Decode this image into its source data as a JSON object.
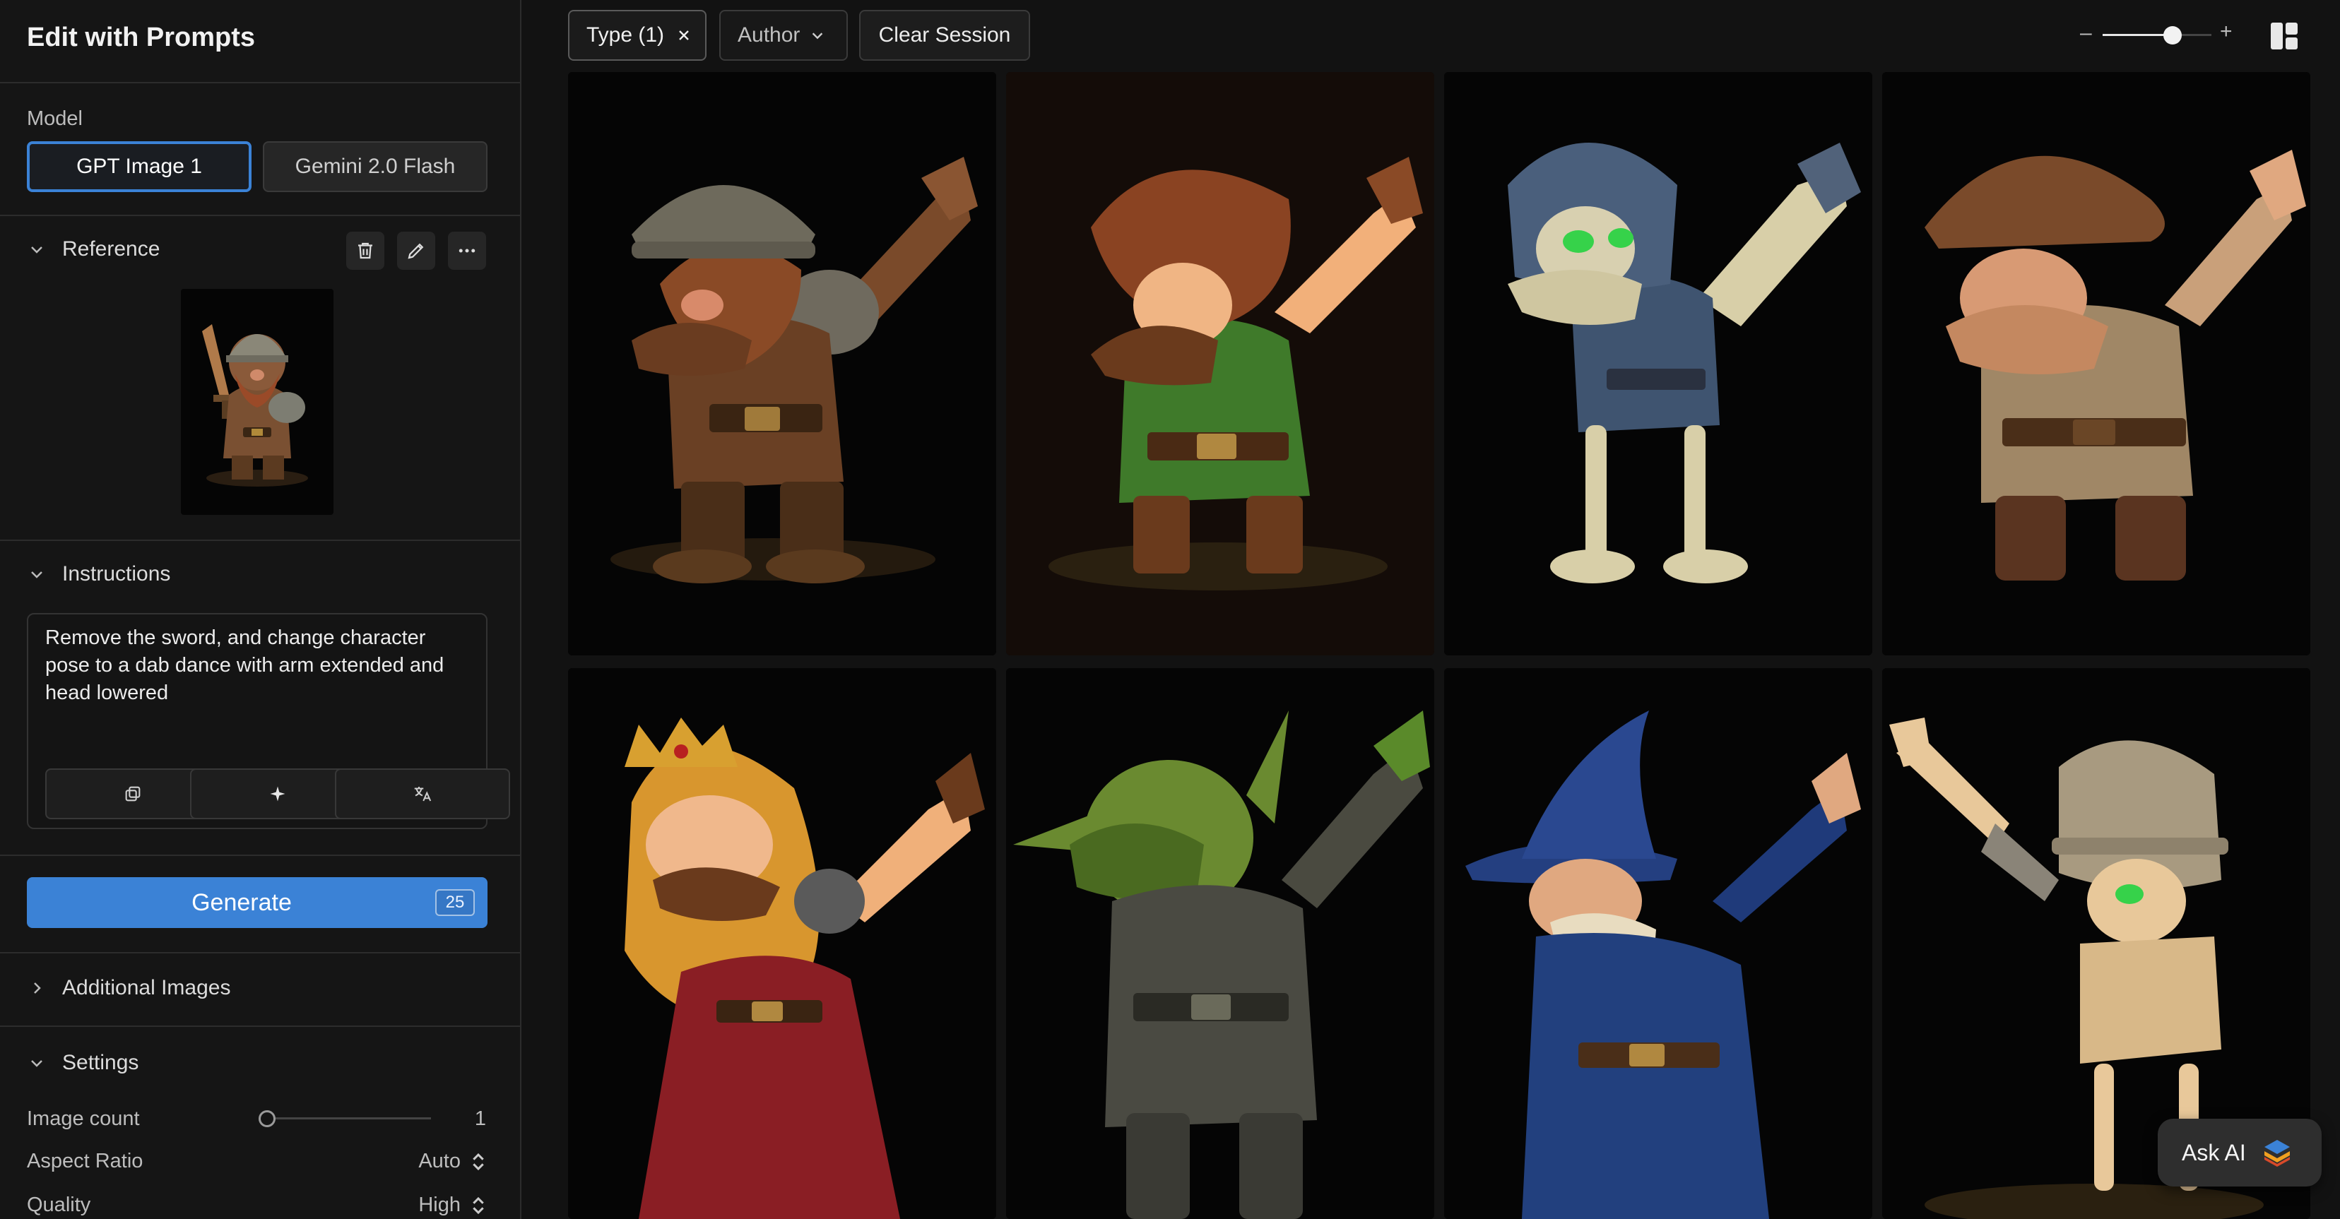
{
  "sidebar": {
    "title": "Edit with Prompts",
    "model": {
      "label": "Model",
      "options": [
        {
          "label": "GPT Image 1",
          "selected": true
        },
        {
          "label": "Gemini 2.0 Flash",
          "selected": false
        }
      ]
    },
    "reference": {
      "title": "Reference",
      "actions": [
        "trash-icon",
        "pencil-icon",
        "more-icon"
      ]
    },
    "instructions": {
      "title": "Instructions",
      "text": "Remove the sword, and change character pose to a dab dance with arm extended and head lowered",
      "tools": [
        "copy-icon",
        "sparkle-icon",
        "translate-icon"
      ]
    },
    "generate": {
      "label": "Generate",
      "count": "25",
      "color": "#3b82d6"
    },
    "additional_images": {
      "title": "Additional Images"
    },
    "settings": {
      "title": "Settings",
      "image_count": {
        "label": "Image count",
        "value": "1"
      },
      "aspect_ratio": {
        "label": "Aspect Ratio",
        "value": "Auto"
      },
      "quality": {
        "label": "Quality",
        "value": "High"
      }
    }
  },
  "topbar": {
    "filters": [
      {
        "label": "Type (1)",
        "removable": true
      },
      {
        "label": "Author",
        "dropdown": true
      }
    ],
    "clear_label": "Clear Session",
    "zoom": {
      "minus": "–",
      "plus": "+",
      "level": 0.64
    },
    "layout_icon": "layout-grid-icon"
  },
  "gallery": {
    "tiles": [
      {
        "subject": "dwarf-dab"
      },
      {
        "subject": "elf-boy-dab"
      },
      {
        "subject": "armored-skeleton-dab"
      },
      {
        "subject": "gnome-dab"
      },
      {
        "subject": "princess-dab"
      },
      {
        "subject": "goblin-dab"
      },
      {
        "subject": "wizard-dab"
      },
      {
        "subject": "skeleton-helmet-dab"
      }
    ]
  },
  "ask_ai": {
    "label": "Ask AI"
  }
}
